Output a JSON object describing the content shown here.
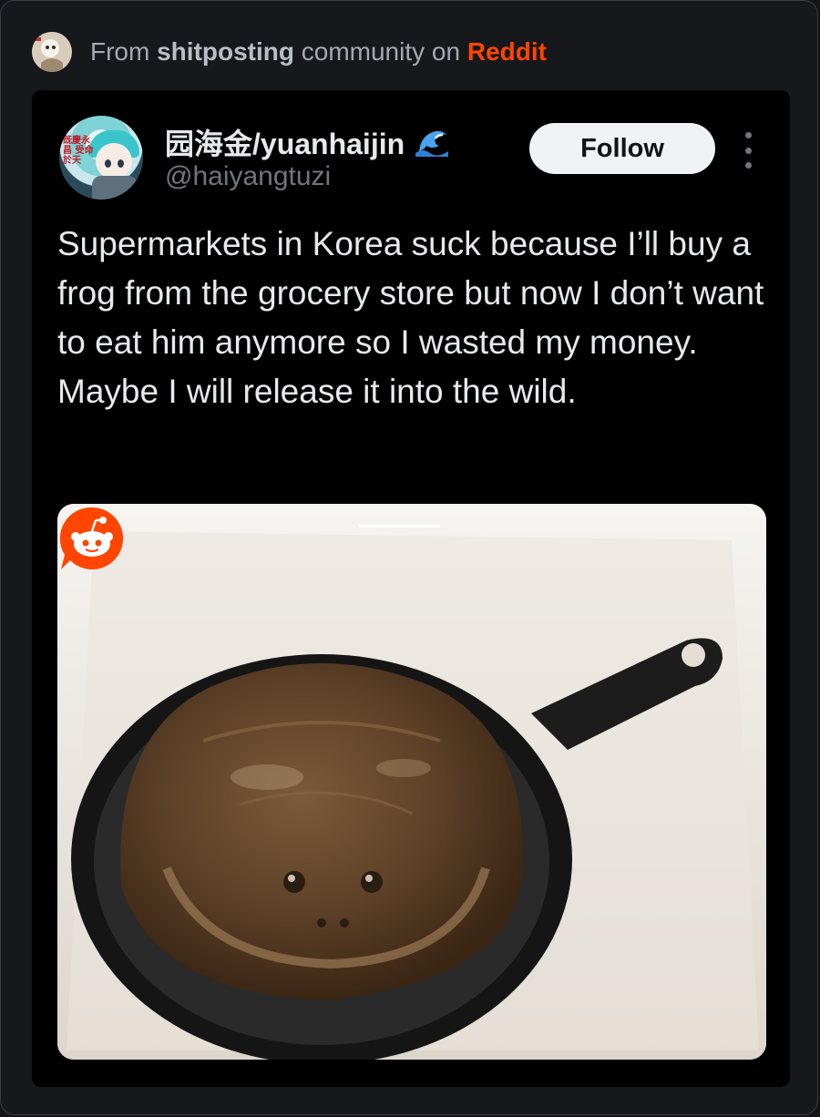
{
  "source": {
    "prefix": "From",
    "community": "shitposting",
    "middle": "community on",
    "platform": "Reddit"
  },
  "tweet": {
    "author_name": "园海金/yuanhaijin",
    "author_handle": "@haiyangtuzi",
    "avatar_text": "既慶永昌 受命於天",
    "follow_label": "Follow",
    "text": "Supermarkets in Korea suck because I’ll buy a frog from the grocery store but now I don’t want to eat him anymore so I wasted my money. Maybe I will release it into the wild.",
    "media_description_icon": "frog-in-pan-photo",
    "badge_icon": "reddit-icon"
  },
  "colors": {
    "reddit_orange": "#ff4500",
    "follow_bg": "#eff3f4",
    "tweet_bg": "#000000",
    "card_bg": "#16181c"
  }
}
